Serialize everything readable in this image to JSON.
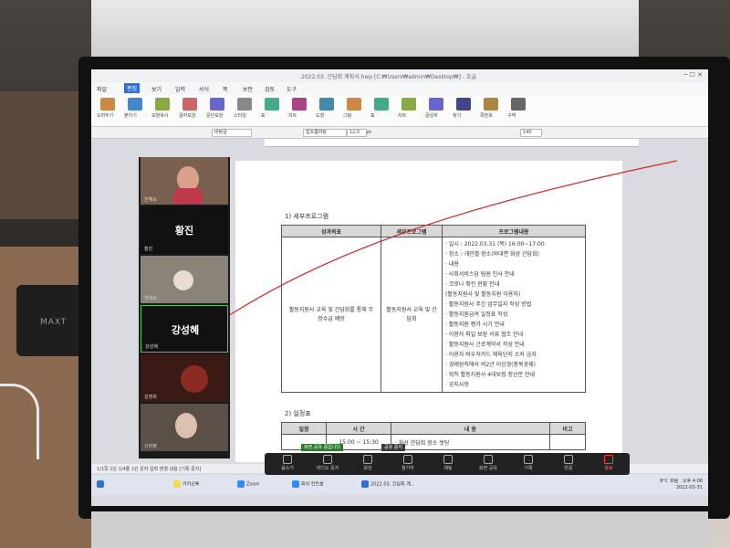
{
  "window": {
    "title": "2022.03. 간담회 계획서.hwp [C:₩Users₩admin₩Desktop₩] - 호글"
  },
  "menu": {
    "items": [
      "파일",
      "편집",
      "보기",
      "입력",
      "서식",
      "쪽",
      "보안",
      "검토",
      "도구"
    ]
  },
  "ribbon": {
    "labels": [
      "오려두기",
      "붙이기",
      "모양복사",
      "글자모양",
      "문단모양",
      "스타일",
      "표",
      "차트",
      "도형",
      "그림",
      "표",
      "차트",
      "글상자",
      "찾기",
      "쪽번호",
      "구역"
    ]
  },
  "format_bar": {
    "style": "바탕글",
    "font": "함초롬바탕",
    "size": "12.0",
    "unit": "pt",
    "zoom": "140"
  },
  "document": {
    "section1_title": "1) 세부프로그램",
    "table1_headers": [
      "성과목표",
      "세부프로그램",
      "프로그램내용"
    ],
    "goal": "활동지원사 교육 및 간담회를 통해 무항수급 예방",
    "program": "활동지원사 교육 및 간담회",
    "contents": [
      "· 일시 : 2022.03.31 (목) 16:00~17:00",
      "· 장소 : 개인별 장소(비대면 화상 간담회)",
      "· 내용",
      "· 사회서비스답 팀원 인사 안내",
      "· 코로나 확진 현황 안내",
      "  (활동지원사 및 활동지원 이용자)",
      "· 활동지원사 주간 업무일지 작성 방법",
      "· 활동지원급여 일정표 작성",
      "· 활동지원 평가 시기 안내",
      "· 이용자 파일 보완 서류 협조 안내",
      "· 활동지원사 근로계약서 작성 안내",
      "· 이용자 바우처카드 체육단지 소지 금지",
      "· 경제원칙에서 여2년 이상경(중복경제)",
      "· 퇴직 활동지원사 4대보험 정산분 안내",
      "· 공지사항"
    ],
    "section2_title": "2) 일정표",
    "table2_headers": [
      "일정",
      "시 간",
      "내 용",
      "비고"
    ],
    "table2_rows": [
      {
        "time": "15:00 ~ 15:30",
        "content": "· 화상 간담회 장소 셋팅"
      }
    ]
  },
  "participants": [
    {
      "name": "진혜숙",
      "display": ""
    },
    {
      "name": "황진",
      "display": "황진"
    },
    {
      "name": "안대숙",
      "display": ""
    },
    {
      "name": "강성혜",
      "display": "강성혜"
    },
    {
      "name": "김영희",
      "display": ""
    },
    {
      "name": "신미정",
      "display": ""
    }
  ],
  "status_bar": {
    "text": "1/1쪽  1단  1/4줄  1칸  문자 입력  변경 내용 [기록 중지]"
  },
  "zoom_bar": {
    "buttons": [
      "음소거",
      "비디오 중지",
      "보안",
      "참가자",
      "채팅",
      "화면 공유",
      "기록",
      "반응",
      "종료"
    ],
    "share_tip": "화면 공유 중입니다",
    "stop_tip": "공유 중지"
  },
  "taskbar": {
    "items": [
      "카카오톡",
      "Zoom",
      "회의 컨트롤",
      "2022.03. 간담회 계..."
    ],
    "weather": "8°C 흐림",
    "time": "오후 4:08",
    "date": "2022-03-31"
  },
  "device": {
    "label": "MAXT"
  },
  "colors": {
    "accent": "#2f6fd6",
    "annotation_line": "#d62828",
    "zoom_bg": "#222222"
  }
}
